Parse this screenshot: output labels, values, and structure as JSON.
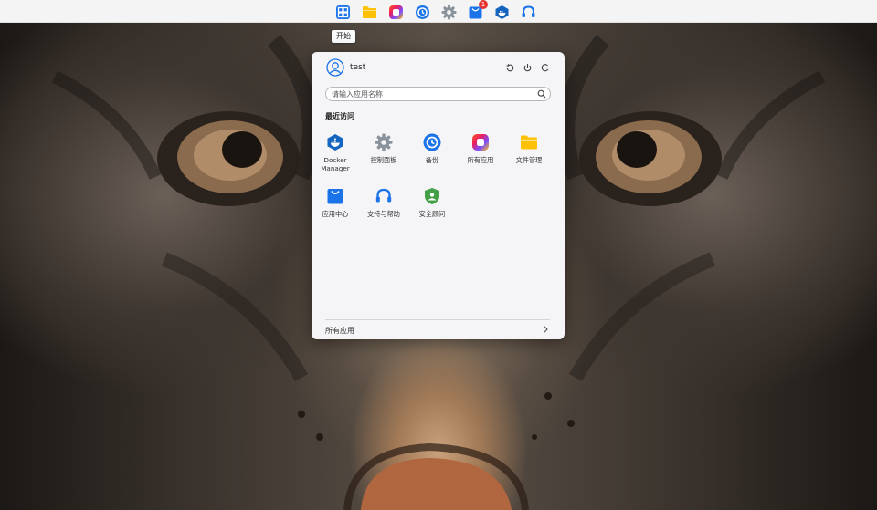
{
  "taskbar": {
    "tooltip": "开始",
    "message_badge": "1",
    "icons": [
      "start-icon",
      "folder-icon",
      "app-store-icon",
      "backup-icon",
      "settings-gear-icon",
      "app-center-icon",
      "docker-icon",
      "headset-icon"
    ]
  },
  "start_menu": {
    "username": "test",
    "search_placeholder": "请输入应用名称",
    "recent_title": "最近访问",
    "apps": [
      {
        "label": "Docker Manager",
        "icon": "docker-icon"
      },
      {
        "label": "控制面板",
        "icon": "settings-gear-icon"
      },
      {
        "label": "备份",
        "icon": "backup-icon"
      },
      {
        "label": "所有应用",
        "icon": "app-store-icon"
      },
      {
        "label": "文件管理",
        "icon": "folder-icon"
      },
      {
        "label": "应用中心",
        "icon": "app-center-icon"
      },
      {
        "label": "支持与帮助",
        "icon": "headset-icon"
      },
      {
        "label": "安全顾问",
        "icon": "security-shield-icon"
      }
    ],
    "footer_label": "所有应用"
  },
  "colors": {
    "accent_blue": "#1a73e8",
    "folder_yellow": "#ffc107",
    "security_green": "#43a047",
    "badge_red": "#e8322e",
    "menu_bg": "#f5f5f7",
    "taskbar_bg": "#f4f4f5"
  }
}
